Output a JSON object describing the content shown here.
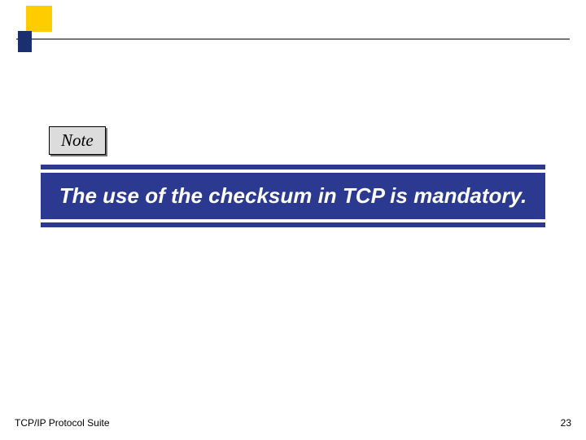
{
  "note": {
    "label": "Note"
  },
  "banner": {
    "text": "The use of the checksum in TCP is mandatory."
  },
  "footer": {
    "left": "TCP/IP Protocol Suite",
    "page": "23"
  }
}
